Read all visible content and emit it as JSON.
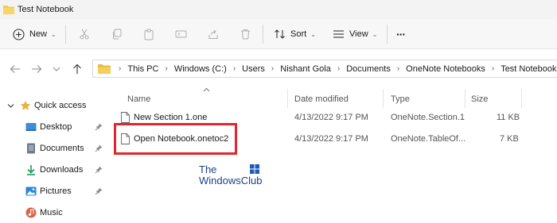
{
  "window": {
    "title": "Test Notebook"
  },
  "toolbar": {
    "new_label": "New",
    "sort_label": "Sort",
    "view_label": "View",
    "more_label": "···"
  },
  "breadcrumb": [
    "This PC",
    "Windows (C:)",
    "Users",
    "Nishant Gola",
    "Documents",
    "OneNote Notebooks",
    "Test Notebook"
  ],
  "sidebar": {
    "items": [
      {
        "label": "Quick access",
        "icon": "star-icon",
        "color": "#e8b339"
      },
      {
        "label": "Desktop",
        "icon": "desktop-icon",
        "color": "#3b8ed8"
      },
      {
        "label": "Documents",
        "icon": "documents-icon",
        "color": "#6d7b8c"
      },
      {
        "label": "Downloads",
        "icon": "download-icon",
        "color": "#1a9b52"
      },
      {
        "label": "Pictures",
        "icon": "pictures-icon",
        "color": "#2f86d6"
      },
      {
        "label": "Music",
        "icon": "music-icon",
        "color": "#d8654c"
      }
    ]
  },
  "columns": {
    "name": "Name",
    "date": "Date modified",
    "type": "Type",
    "size": "Size"
  },
  "files": [
    {
      "name": "New Section 1.one",
      "date": "4/13/2022 9:17 PM",
      "type": "OneNote.Section.1",
      "size": "11 KB"
    },
    {
      "name": "Open Notebook.onetoc2",
      "date": "4/13/2022 9:17 PM",
      "type": "OneNote.TableOf...",
      "size": "7 KB"
    }
  ],
  "watermark": {
    "line1": "The",
    "line2": "WindowsClub"
  },
  "colors": {
    "highlight": "#e2262b",
    "watermark": "#1c3f88",
    "folder": "#f2c94c"
  }
}
